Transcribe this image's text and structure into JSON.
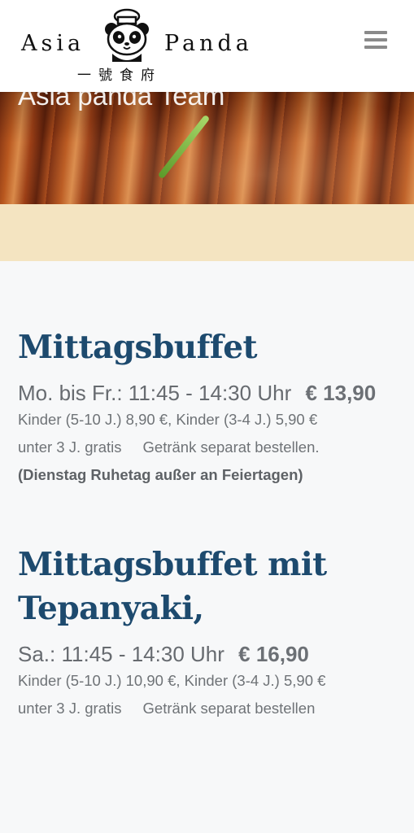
{
  "header": {
    "logo": {
      "word_left": "Asia",
      "word_right": "Panda",
      "cjk": "一號食府"
    },
    "menu_icon": "hamburger-menu-icon"
  },
  "hero": {
    "caption": "Asia panda Team"
  },
  "sections": [
    {
      "title": "Mittagsbuffet",
      "schedule": "Mo. bis Fr.: 11:45 - 14:30 Uhr",
      "price": "€ 13,90",
      "children_prices": "Kinder (5-10 J.) 8,90 €, Kinder (3-4 J.) 5,90 €",
      "under3": "unter 3 J. gratis",
      "drinks": "Getränk separat bestellen.",
      "note": "(Dienstag Ruhetag außer an Feiertagen)"
    },
    {
      "title_line1": "Mittagsbuffet mit",
      "title_line2": "Tepanyaki,",
      "schedule": "Sa.: 11:45 - 14:30 Uhr",
      "price": "€ 16,90",
      "children_prices": "Kinder (5-10 J.) 10,90 €, Kinder (3-4 J.) 5,90 €",
      "under3": "unter 3 J. gratis",
      "drinks": "Getränk separat bestellen"
    }
  ],
  "colors": {
    "title": "#1d4a6e",
    "band": "#f4e4c1",
    "body_text": "#6f7377",
    "background": "#f7f8f9"
  }
}
